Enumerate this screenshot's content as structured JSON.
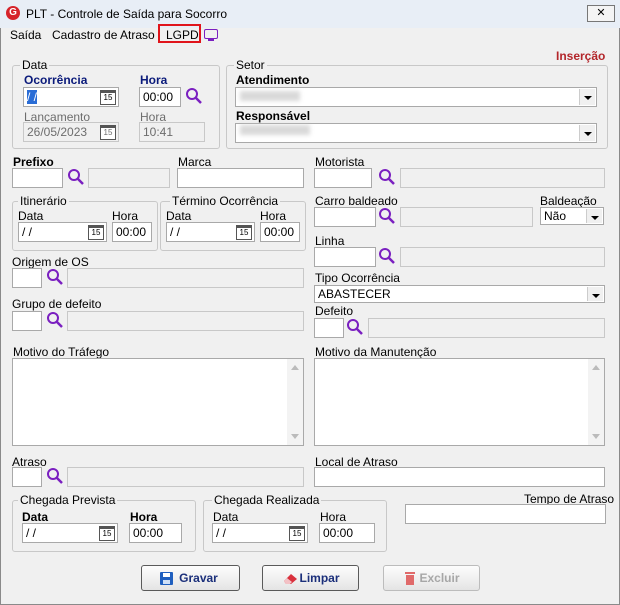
{
  "window": {
    "title": "PLT - Controle de Saída para Socorro",
    "close": "✕"
  },
  "menu": {
    "saida": "Saída",
    "cadastro_atraso": "Cadastro de Atraso",
    "lgpd": "LGPD"
  },
  "mode": "Inserção",
  "data_group": {
    "legend": "Data",
    "ocorrencia_label": "Ocorrência",
    "ocorrencia_value": " / /",
    "hora_label": "Hora",
    "hora_value": "00:00",
    "lancamento_label": "Lançamento",
    "lancamento_value": "26/05/2023",
    "hora2_label": "Hora",
    "hora2_value": "10:41"
  },
  "setor_group": {
    "legend": "Setor",
    "atendimento_label": "Atendimento",
    "responsavel_label": "Responsável"
  },
  "prefixo_label": "Prefixo",
  "marca_label": "Marca",
  "motorista_label": "Motorista",
  "itinerario": {
    "legend": "Itinerário",
    "data_label": "Data",
    "data_value": " / /",
    "hora_label": "Hora",
    "hora_value": "00:00"
  },
  "termino": {
    "legend": "Término Ocorrência",
    "data_label": "Data",
    "data_value": " / /",
    "hora_label": "Hora",
    "hora_value": "00:00"
  },
  "carro_baldeado_label": "Carro baldeado",
  "baldeacao_label": "Baldeação",
  "baldeacao_value": "Não",
  "linha_label": "Linha",
  "origem_os_label": "Origem de OS",
  "grupo_defeito_label": "Grupo de defeito",
  "tipo_ocorrencia_label": "Tipo Ocorrência",
  "tipo_ocorrencia_value": "ABASTECER",
  "defeito_label": "Defeito",
  "motivo_trafego_label": "Motivo do Tráfego",
  "motivo_manutencao_label": "Motivo da Manutenção",
  "atraso_label": "Atraso",
  "local_atraso_label": "Local de Atraso",
  "tempo_atraso_label": "Tempo de Atraso",
  "chegada_prevista": {
    "legend": "Chegada Prevista",
    "data_label": "Data",
    "data_value": " / /",
    "hora_label": "Hora",
    "hora_value": "00:00"
  },
  "chegada_realizada": {
    "legend": "Chegada Realizada",
    "data_label": "Data",
    "data_value": " / /",
    "hora_label": "Hora",
    "hora_value": "00:00"
  },
  "buttons": {
    "gravar": "Gravar",
    "limpar": "Limpar",
    "excluir": "Excluir"
  }
}
